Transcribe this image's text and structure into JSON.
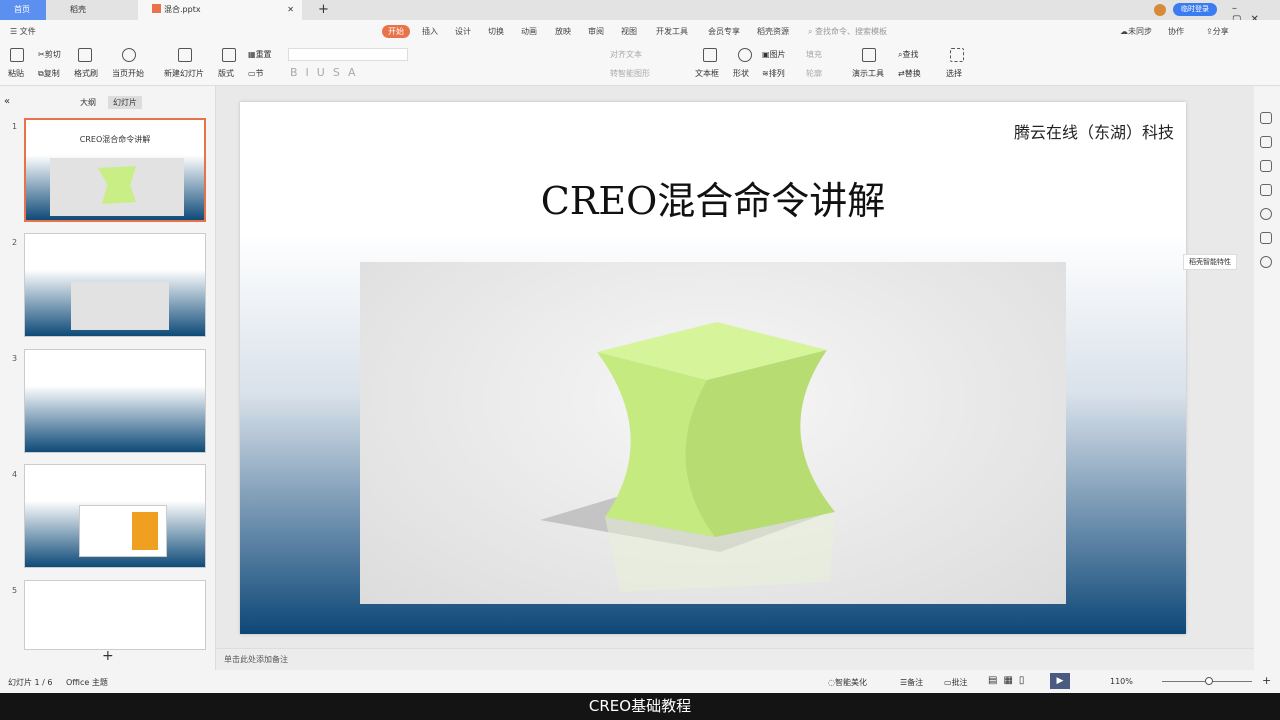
{
  "tabs": [
    {
      "label": "首页"
    },
    {
      "label": "稻壳"
    },
    {
      "label": "混合.pptx"
    }
  ],
  "titlebar": {
    "login": "临时登录"
  },
  "menu": {
    "file": "文件",
    "items": [
      "开始",
      "插入",
      "设计",
      "切换",
      "动画",
      "放映",
      "审阅",
      "视图",
      "开发工具",
      "会员专享",
      "稻壳资源"
    ],
    "search_placeholder": "查找命令、搜索模板",
    "sync": "未同步",
    "collab": "协作",
    "share": "分享"
  },
  "ribbon": {
    "paste": "粘贴",
    "cut": "剪切",
    "copy": "复制",
    "format_painter": "格式刷",
    "play_from_current": "当页开始",
    "new_slide": "新建幻灯片",
    "layout": "版式",
    "reset": "重置",
    "section": "节",
    "align_text": "对齐文本",
    "smart_art": "转智能图形",
    "textbox": "文本框",
    "shape": "形状",
    "picture": "图片",
    "arrange": "排列",
    "fill": "填充",
    "outline": "轮廓",
    "presentation_tools": "演示工具",
    "find": "查找",
    "replace": "替换",
    "select": "选择"
  },
  "panel": {
    "tab_outline": "大纲",
    "tab_slides": "幻灯片",
    "slide_numbers": [
      "1",
      "2",
      "3",
      "4",
      "5"
    ],
    "thumb1_title": "CREO混合命令讲解"
  },
  "slide": {
    "company": "腾云在线（东湖）科技",
    "title": "CREO混合命令讲解"
  },
  "sidebar": {
    "tooltip": "稻壳智能特性"
  },
  "notes": {
    "placeholder": "单击此处添加备注"
  },
  "status": {
    "slide_count": "幻灯片 1 / 6",
    "theme": "Office 主题",
    "beautify": "智能美化",
    "notes": "备注",
    "comments": "批注",
    "zoom": "110%"
  },
  "subtitle": "CREO基础教程",
  "colors": {
    "accent": "#e8734a",
    "login": "#3b7cf0",
    "slide_bottom": "#0d4777",
    "shape": "#c9ee86"
  }
}
